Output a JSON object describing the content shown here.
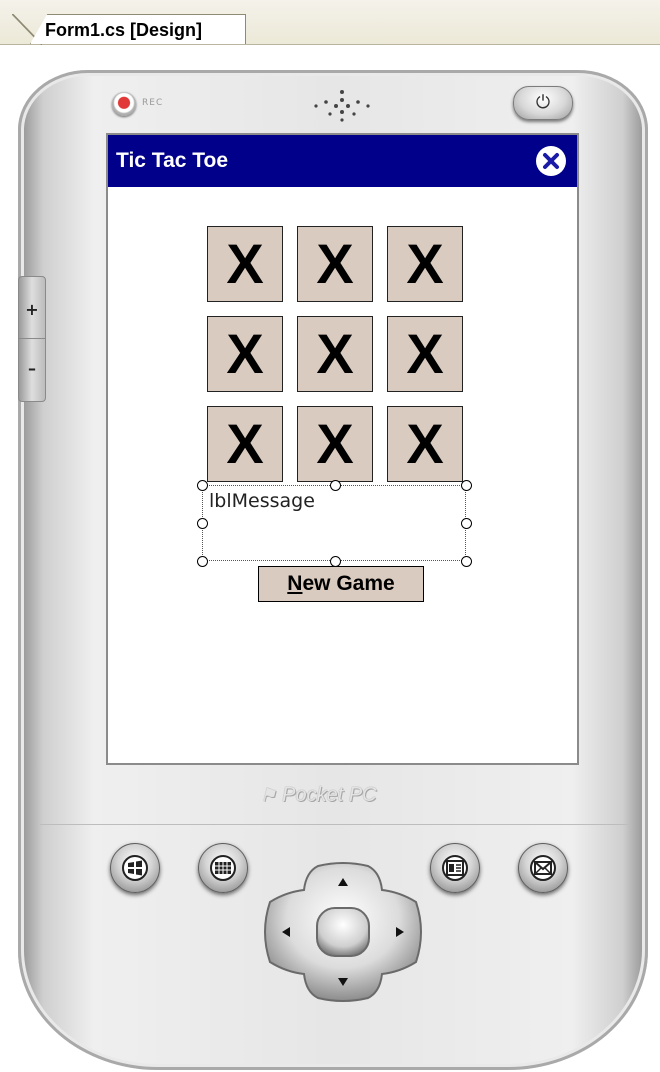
{
  "ide": {
    "tab_label": "Form1.cs [Design]"
  },
  "device": {
    "rocker_plus": "+",
    "rocker_minus": "–",
    "rec_label": "REC",
    "brand_logo": "Pocket PC"
  },
  "form": {
    "title": "Tic Tac Toe",
    "title_bar_color": "#00008b",
    "close_icon": "close-circle-icon",
    "board": [
      [
        "X",
        "X",
        "X"
      ],
      [
        "X",
        "X",
        "X"
      ],
      [
        "X",
        "X",
        "X"
      ]
    ],
    "cell_color": "#d9cbbf",
    "message_label": "lblMessage",
    "new_game_button": {
      "mnemonic": "N",
      "rest": "ew Game"
    }
  },
  "hardware_buttons": {
    "start": "windows-flag-icon",
    "calendar": "calendar-icon",
    "contacts": "contacts-icon",
    "inbox": "envelope-icon"
  }
}
